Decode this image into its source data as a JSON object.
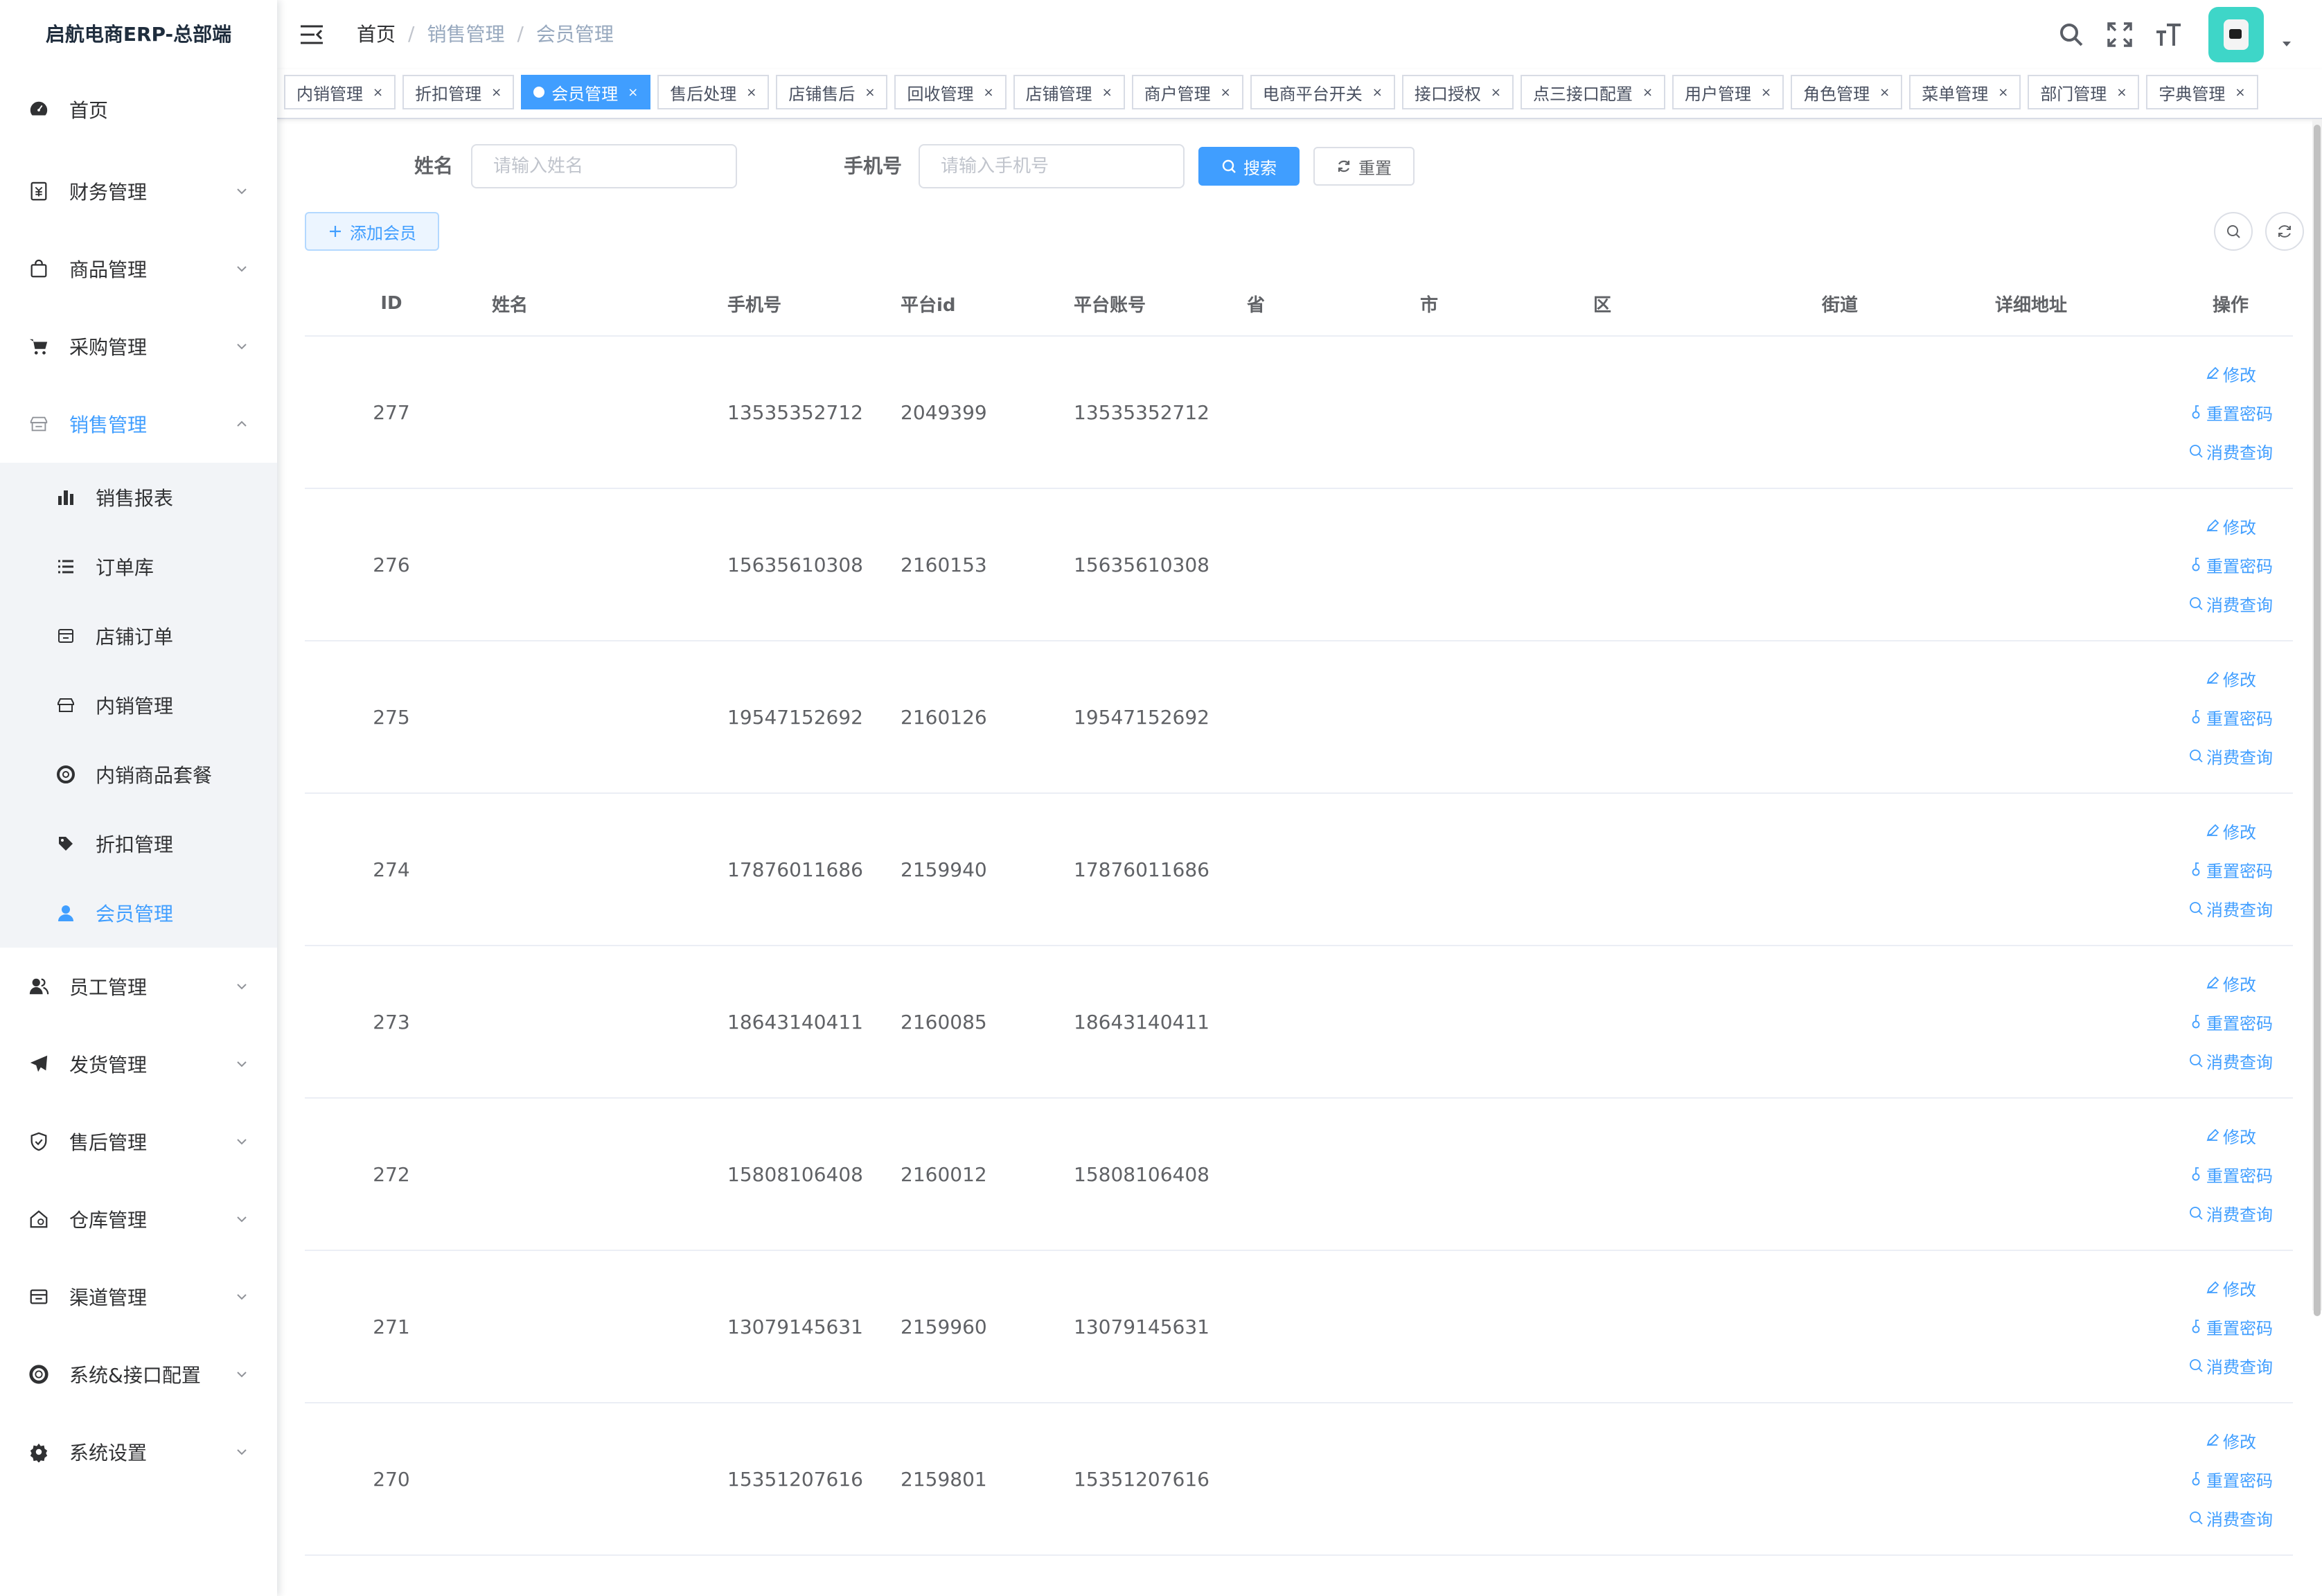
{
  "app": {
    "title": "启航电商ERP-总部端"
  },
  "sidebar": {
    "items": [
      {
        "label": "首页",
        "icon": "dashboard-icon"
      },
      {
        "label": "财务管理",
        "icon": "finance-icon"
      },
      {
        "label": "商品管理",
        "icon": "shopping-bag-icon"
      },
      {
        "label": "采购管理",
        "icon": "cart-icon"
      },
      {
        "label": "销售管理",
        "icon": "shop-icon",
        "expanded": true
      },
      {
        "label": "员工管理",
        "icon": "people-icon"
      },
      {
        "label": "发货管理",
        "icon": "send-icon"
      },
      {
        "label": "售后管理",
        "icon": "shield-icon"
      },
      {
        "label": "仓库管理",
        "icon": "warehouse-icon"
      },
      {
        "label": "渠道管理",
        "icon": "store-icon"
      },
      {
        "label": "系统&接口配置",
        "icon": "lifebuoy-icon"
      },
      {
        "label": "系统设置",
        "icon": "gear-icon"
      }
    ],
    "sales_children": [
      {
        "label": "销售报表",
        "icon": "bar-chart-icon"
      },
      {
        "label": "订单库",
        "icon": "list-icon"
      },
      {
        "label": "店铺订单",
        "icon": "store-icon"
      },
      {
        "label": "内销管理",
        "icon": "shop-icon"
      },
      {
        "label": "内销商品套餐",
        "icon": "lifebuoy-icon"
      },
      {
        "label": "折扣管理",
        "icon": "discount-icon"
      },
      {
        "label": "会员管理",
        "icon": "user-icon",
        "active": true
      }
    ]
  },
  "breadcrumb": {
    "home": "首页",
    "level1": "销售管理",
    "level2": "会员管理"
  },
  "tags": [
    {
      "label": "内销管理"
    },
    {
      "label": "折扣管理"
    },
    {
      "label": "会员管理",
      "active": true
    },
    {
      "label": "售后处理"
    },
    {
      "label": "店铺售后"
    },
    {
      "label": "回收管理"
    },
    {
      "label": "店铺管理"
    },
    {
      "label": "商户管理"
    },
    {
      "label": "电商平台开关"
    },
    {
      "label": "接口授权"
    },
    {
      "label": "点三接口配置"
    },
    {
      "label": "用户管理"
    },
    {
      "label": "角色管理"
    },
    {
      "label": "菜单管理"
    },
    {
      "label": "部门管理"
    },
    {
      "label": "字典管理"
    }
  ],
  "search": {
    "name_label": "姓名",
    "name_placeholder": "请输入姓名",
    "phone_label": "手机号",
    "phone_placeholder": "请输入手机号",
    "search_button": "搜索",
    "reset_button": "重置"
  },
  "toolbar": {
    "add_button": "添加会员"
  },
  "table": {
    "columns": [
      "ID",
      "姓名",
      "手机号",
      "平台id",
      "平台账号",
      "省",
      "市",
      "区",
      "街道",
      "详细地址",
      "操作"
    ],
    "actions": {
      "edit": "修改",
      "reset_pwd": "重置密码",
      "consume": "消费查询"
    },
    "rows": [
      {
        "id": "277",
        "name": "",
        "phone": "13535352712",
        "platform_id": "2049399",
        "account": "13535352712"
      },
      {
        "id": "276",
        "name": "",
        "phone": "15635610308",
        "platform_id": "2160153",
        "account": "15635610308"
      },
      {
        "id": "275",
        "name": "",
        "phone": "19547152692",
        "platform_id": "2160126",
        "account": "19547152692"
      },
      {
        "id": "274",
        "name": "",
        "phone": "17876011686",
        "platform_id": "2159940",
        "account": "17876011686"
      },
      {
        "id": "273",
        "name": "",
        "phone": "18643140411",
        "platform_id": "2160085",
        "account": "18643140411"
      },
      {
        "id": "272",
        "name": "",
        "phone": "15808106408",
        "platform_id": "2160012",
        "account": "15808106408"
      },
      {
        "id": "271",
        "name": "",
        "phone": "13079145631",
        "platform_id": "2159960",
        "account": "13079145631"
      },
      {
        "id": "270",
        "name": "",
        "phone": "15351207616",
        "platform_id": "2159801",
        "account": "15351207616"
      }
    ]
  },
  "colors": {
    "primary": "#409eff",
    "sidebar_sub_bg": "#f2f4f7",
    "avatar_bg": "#3ed6c8"
  }
}
